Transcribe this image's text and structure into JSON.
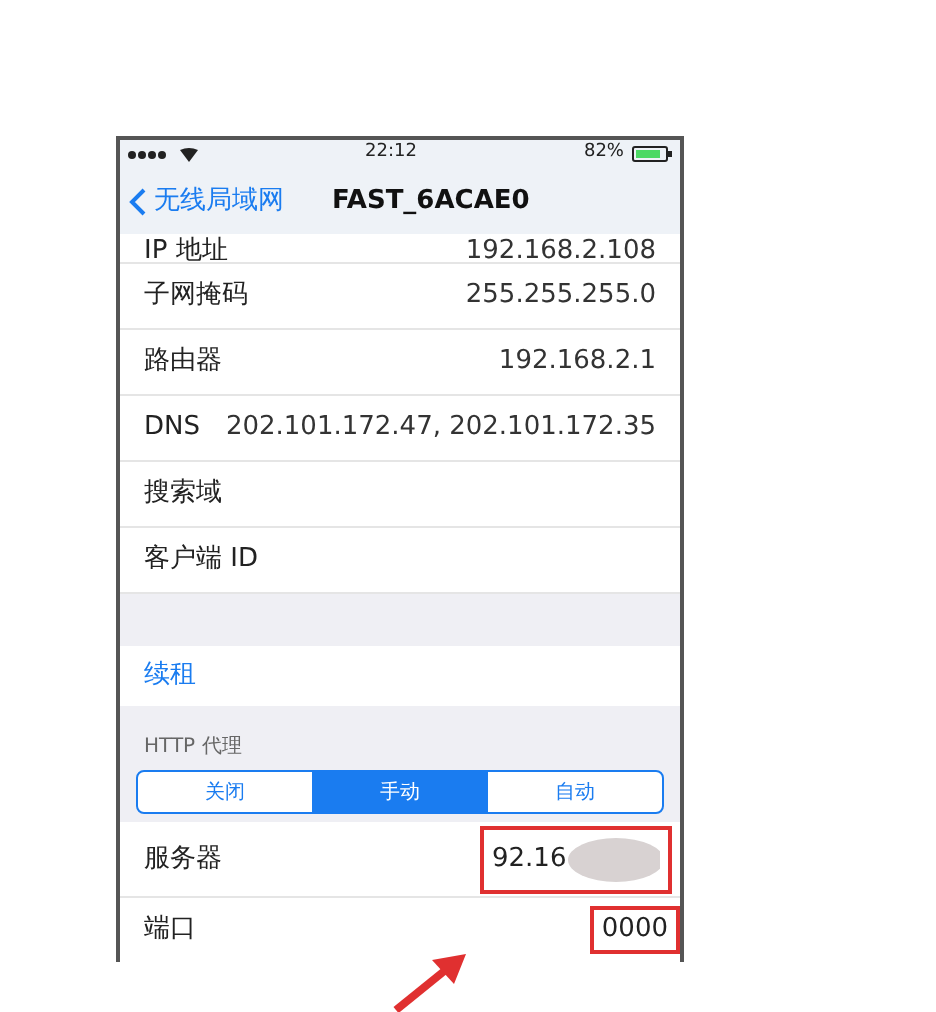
{
  "status_bar": {
    "time": "22:12",
    "battery": "82%"
  },
  "nav": {
    "back": "无线局域网",
    "title": "FAST_6ACAE0"
  },
  "rows": [
    {
      "label": "IP 地址",
      "value": "192.168.2.108",
      "kind": "cut"
    },
    {
      "label": "子网掩码",
      "value": "255.255.255.0",
      "kind": "row"
    },
    {
      "label": "路由器",
      "value": "192.168.2.1",
      "kind": "row"
    },
    {
      "label": "DNS",
      "value": "202.101.172.47, 202.101.172.35",
      "kind": "row"
    },
    {
      "label": "搜索域",
      "kind": "row"
    },
    {
      "label": "客户端 ID",
      "kind": "row"
    }
  ],
  "renew": "续租",
  "proxy": {
    "header": "HTTP 代理",
    "segments": [
      {
        "label": "关闭",
        "selected": false
      },
      {
        "label": "手动",
        "selected": true
      },
      {
        "label": "自动",
        "selected": false
      }
    ],
    "server": {
      "label": "服务器",
      "value": "92.16"
    },
    "port": {
      "label": "端口",
      "value": "0000"
    }
  }
}
